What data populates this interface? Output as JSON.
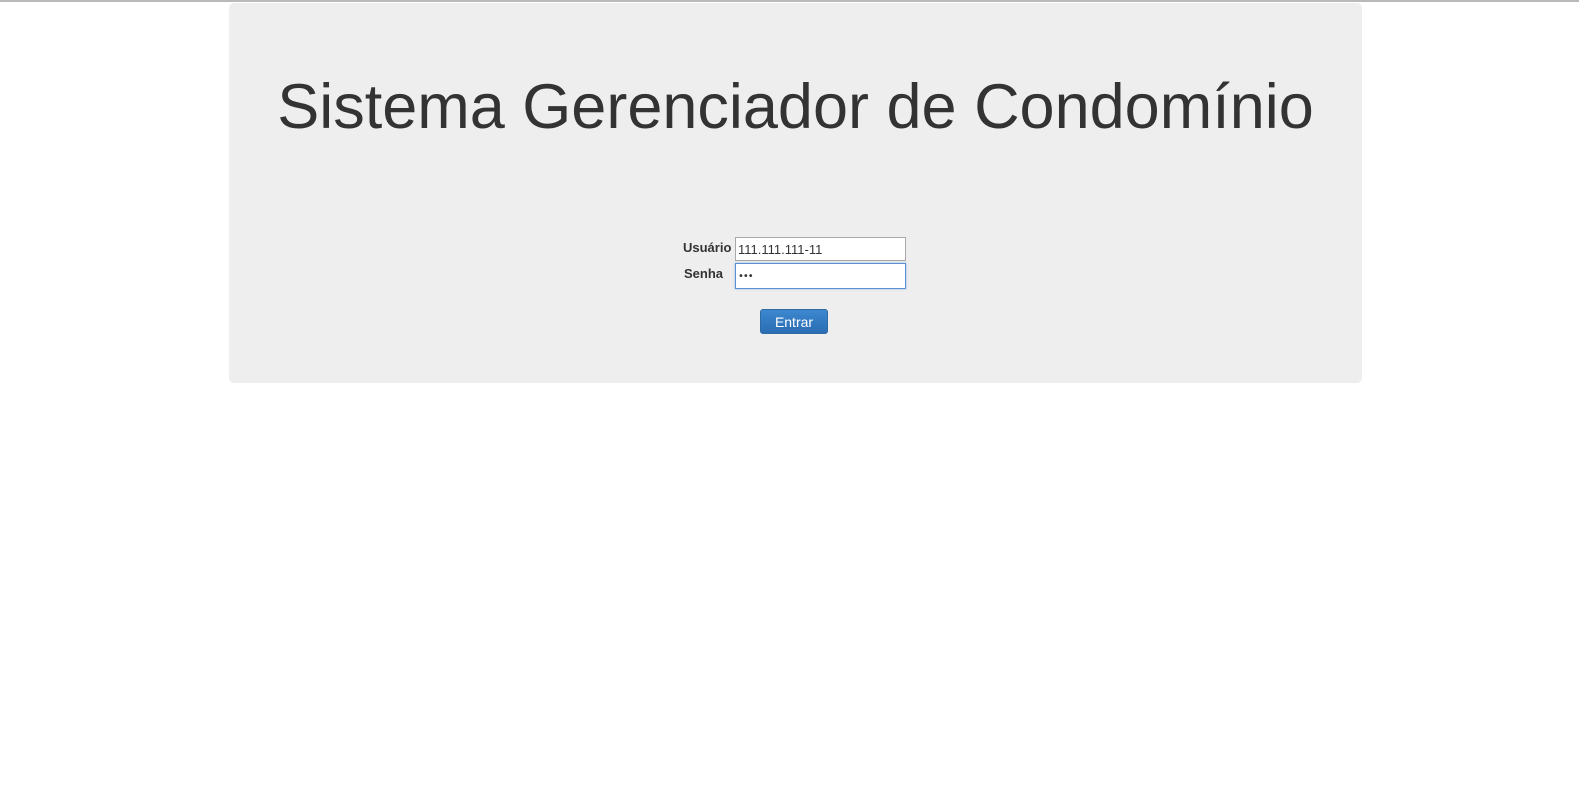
{
  "page": {
    "title": "Sistema Gerenciador de Condomínio"
  },
  "login_form": {
    "user_label": "Usuário",
    "user_value": "111.111.111-11",
    "password_label": "Senha",
    "password_value": "•••",
    "submit_label": "Entrar"
  },
  "colors": {
    "panel_background": "#eeeeee",
    "title_text": "#333333",
    "button_primary": "#337ab7",
    "focus_border": "#5b8fd6"
  }
}
